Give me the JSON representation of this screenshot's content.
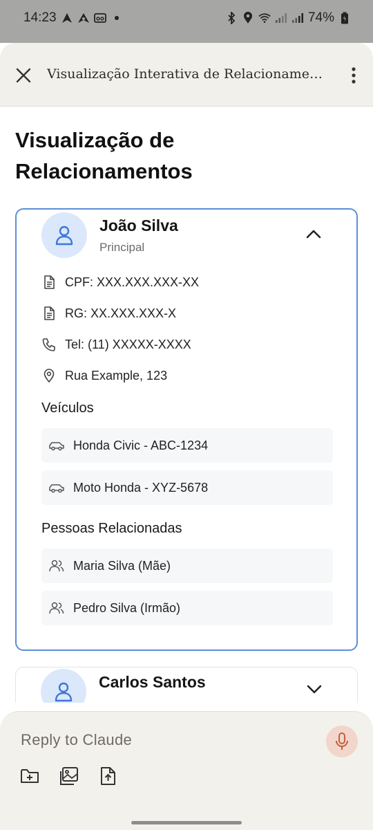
{
  "status_bar": {
    "time": "14:23",
    "battery": "74%"
  },
  "header": {
    "title": "Visualização Interativa de Relacionamentos"
  },
  "page": {
    "heading": "Visualização de Relacionamentos"
  },
  "cards": [
    {
      "name": "João Silva",
      "role": "Principal",
      "details": {
        "cpf": "CPF: XXX.XXX.XXX-XX",
        "rg": "RG: XX.XXX.XXX-X",
        "phone": "Tel: (11) XXXXX-XXXX",
        "address": "Rua Example, 123"
      },
      "vehicles_title": "Veículos",
      "vehicles": [
        "Honda Civic - ABC-1234",
        "Moto Honda - XYZ-5678"
      ],
      "related_title": "Pessoas Relacionadas",
      "related": [
        "Maria Silva (Mãe)",
        "Pedro Silva (Irmão)"
      ]
    },
    {
      "name": "Carlos Santos"
    }
  ],
  "composer": {
    "placeholder": "Reply to Claude"
  },
  "colors": {
    "accent_blue": "#4a7fd6",
    "card_border": "#5b8fd6",
    "mic_bg": "#f2d6cb",
    "mic_fg": "#c4603d"
  }
}
